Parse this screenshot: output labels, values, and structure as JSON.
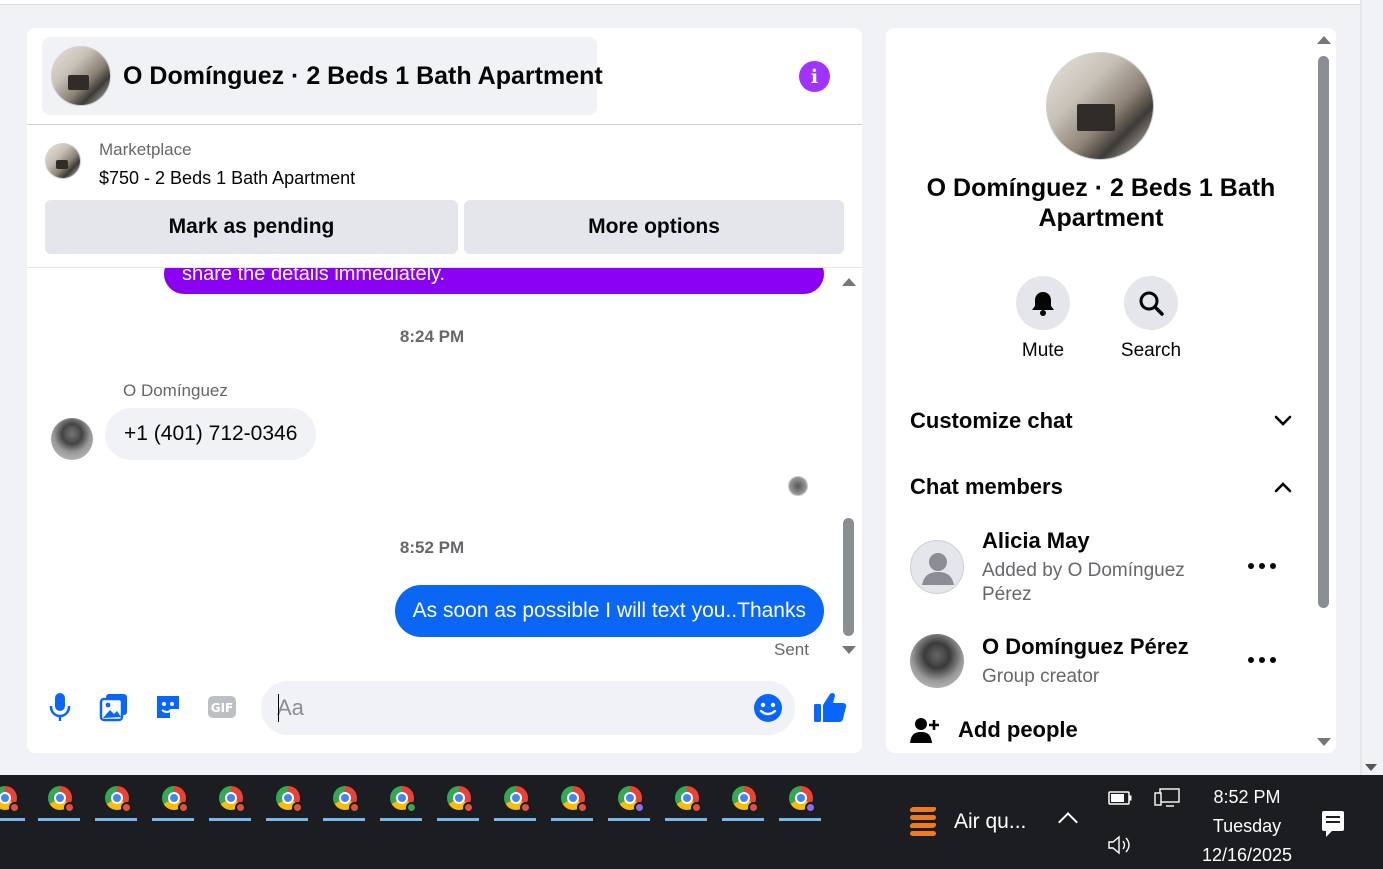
{
  "chat": {
    "title": "O Domínguez · 2 Beds 1 Bath Apartment",
    "marketplace_label": "Marketplace",
    "listing": "$750 - 2 Beds 1 Bath Apartment",
    "mark_pending": "Mark as pending",
    "more_options": "More options",
    "partial_message": "share the details immediately.",
    "timestamp_1": "8:24 PM",
    "sender_name": "O Domínguez",
    "incoming_message": "+1 (401) 712-0346",
    "timestamp_2": "8:52 PM",
    "outgoing_message": "As soon as possible I will text you..Thanks",
    "sent_status": "Sent",
    "input_placeholder": "Aa"
  },
  "side": {
    "title": "O Domínguez · 2 Beds 1 Bath Apartment",
    "mute_label": "Mute",
    "search_label": "Search",
    "customize_chat": "Customize chat",
    "chat_members": "Chat members",
    "members": [
      {
        "name": "Alicia May",
        "subtitle": "Added by O Domínguez Pérez"
      },
      {
        "name": "O Domínguez Pérez",
        "subtitle": "Group creator"
      }
    ],
    "add_people": "Add people"
  },
  "taskbar": {
    "weather": "Air qu...",
    "time": "8:52 PM",
    "day": "Tuesday",
    "date": "12/16/2025"
  },
  "colors": {
    "accent_purple": "#8a00f5",
    "info_purple": "#a033ff",
    "outgoing_blue": "#0a66f4",
    "icon_blue": "#0866ff"
  },
  "icons": [
    "info-icon",
    "microphone-icon",
    "image-icon",
    "sticker-icon",
    "gif-icon",
    "emoji-icon",
    "thumbs-up-icon",
    "bell-icon",
    "search-icon",
    "chevron-down-icon",
    "chevron-up-icon",
    "more-dots-icon",
    "add-person-icon",
    "chrome-icon",
    "weather-icon",
    "battery-icon",
    "network-icon",
    "volume-icon",
    "notification-icon"
  ]
}
